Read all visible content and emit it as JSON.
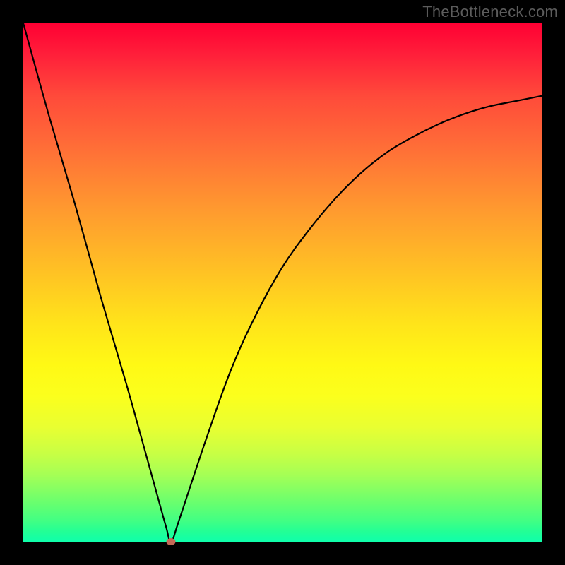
{
  "watermark": "TheBottleneck.com",
  "colors": {
    "frame": "#000000",
    "curve": "#000000",
    "marker": "#c46a57"
  },
  "chart_data": {
    "type": "line",
    "title": "",
    "xlabel": "",
    "ylabel": "",
    "xlim": [
      0,
      100
    ],
    "ylim": [
      0,
      100
    ],
    "legend": false,
    "grid": false,
    "background": "rainbow-vertical (red top → green bottom)",
    "series": [
      {
        "name": "bottleneck-curve",
        "x": [
          0,
          5,
          10,
          15,
          20,
          25,
          27.5,
          28.5,
          30,
          35,
          40,
          45,
          50,
          55,
          60,
          65,
          70,
          75,
          80,
          85,
          90,
          95,
          100
        ],
        "values": [
          100,
          82,
          65,
          47,
          30,
          12,
          3,
          0,
          4,
          19,
          33,
          44,
          53,
          60,
          66,
          71,
          75,
          78,
          80.5,
          82.5,
          84,
          85,
          86
        ]
      }
    ],
    "annotations": [
      {
        "name": "optimal-point",
        "x": 28.5,
        "y": 0
      }
    ]
  }
}
